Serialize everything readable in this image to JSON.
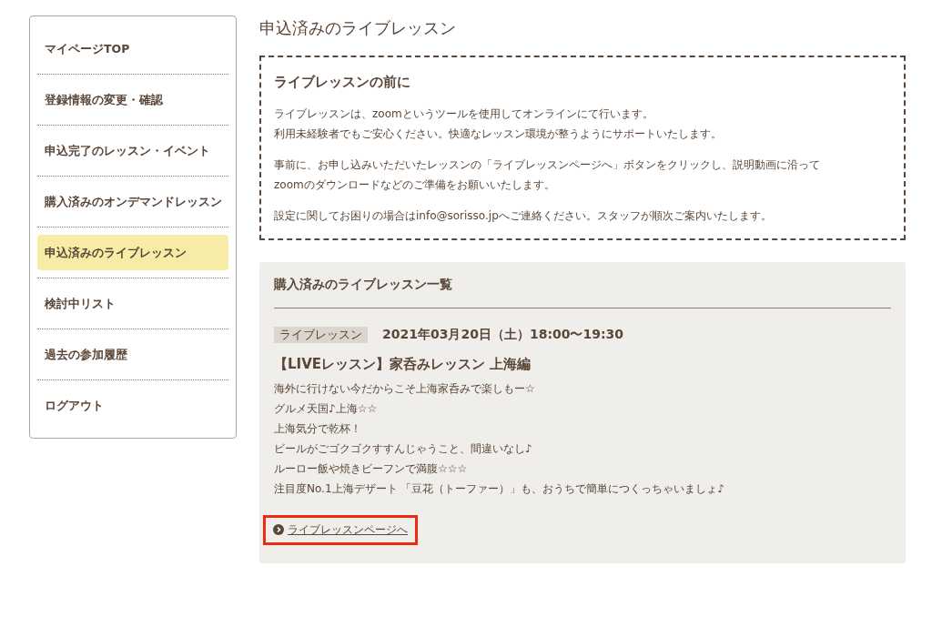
{
  "sidebar": {
    "items": [
      {
        "label": "マイページTOP",
        "selected": false
      },
      {
        "label": "登録情報の変更・確認",
        "selected": false
      },
      {
        "label": "申込完了のレッスン・イベント",
        "selected": false
      },
      {
        "label": "購入済みのオンデマンドレッスン",
        "selected": false
      },
      {
        "label": "申込済みのライブレッスン",
        "selected": true
      },
      {
        "label": "検討中リスト",
        "selected": false
      },
      {
        "label": "過去の参加履歴",
        "selected": false
      },
      {
        "label": "ログアウト",
        "selected": false
      }
    ]
  },
  "page_title": "申込済みのライブレッスン",
  "notice": {
    "heading": "ライブレッスンの前に",
    "paragraphs": [
      [
        "ライブレッスンは、zoomというツールを使用してオンラインにて行います。",
        "利用未経験者でもご安心ください。快適なレッスン環境が整うようにサポートいたします。"
      ],
      [
        "事前に、お申し込みいただいたレッスンの「ライブレッスンページへ」ボタンをクリックし、説明動画に沿って",
        "zoomのダウンロードなどのご準備をお願いいたします。"
      ],
      [
        "設定に関してお困りの場合はinfo@sorisso.jpへご連絡ください。スタッフが順次ご案内いたします。"
      ]
    ]
  },
  "lessons": {
    "heading": "購入済みのライブレッスン一覧",
    "items": [
      {
        "tag": "ライブレッスン",
        "datetime": "2021年03月20日（土）18:00〜19:30",
        "title": "【LIVEレッスン】家呑みレッスン 上海編",
        "description": [
          "海外に行けない今だからこそ上海家呑みで楽しもー☆",
          "グルメ天国♪上海☆☆",
          "上海気分で乾杯！",
          "ビールがごゴクゴクすすんじゃうこと、間違いなし♪",
          "ルーロー飯や焼きビーフンで満腹☆☆☆",
          "注目度No.1上海デザート 「豆花（トーファー）」も、おうちで簡単につくっちゃいましょ♪"
        ],
        "link": {
          "label": "ライブレッスンページへ",
          "highlighted": true
        }
      }
    ]
  }
}
